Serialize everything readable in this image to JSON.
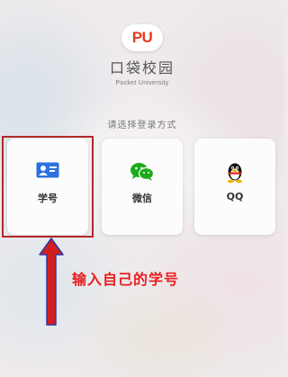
{
  "app": {
    "logo_text": "PU",
    "name": "口袋校园",
    "subtitle": "Pocket University"
  },
  "login": {
    "prompt": "请选择登录方式",
    "options": [
      {
        "label": "学号",
        "icon": "student-id-card-icon",
        "color": "#2e6fe0"
      },
      {
        "label": "微信",
        "icon": "wechat-icon",
        "color": "#1aad19"
      },
      {
        "label": "QQ",
        "icon": "qq-penguin-icon",
        "color": "#111111"
      }
    ]
  },
  "annotation": {
    "text": "输入自己的学号",
    "highlight_color": "#b22a2a",
    "arrow_color": "#d11f1f",
    "arrow_outline": "#2f3aa8"
  }
}
